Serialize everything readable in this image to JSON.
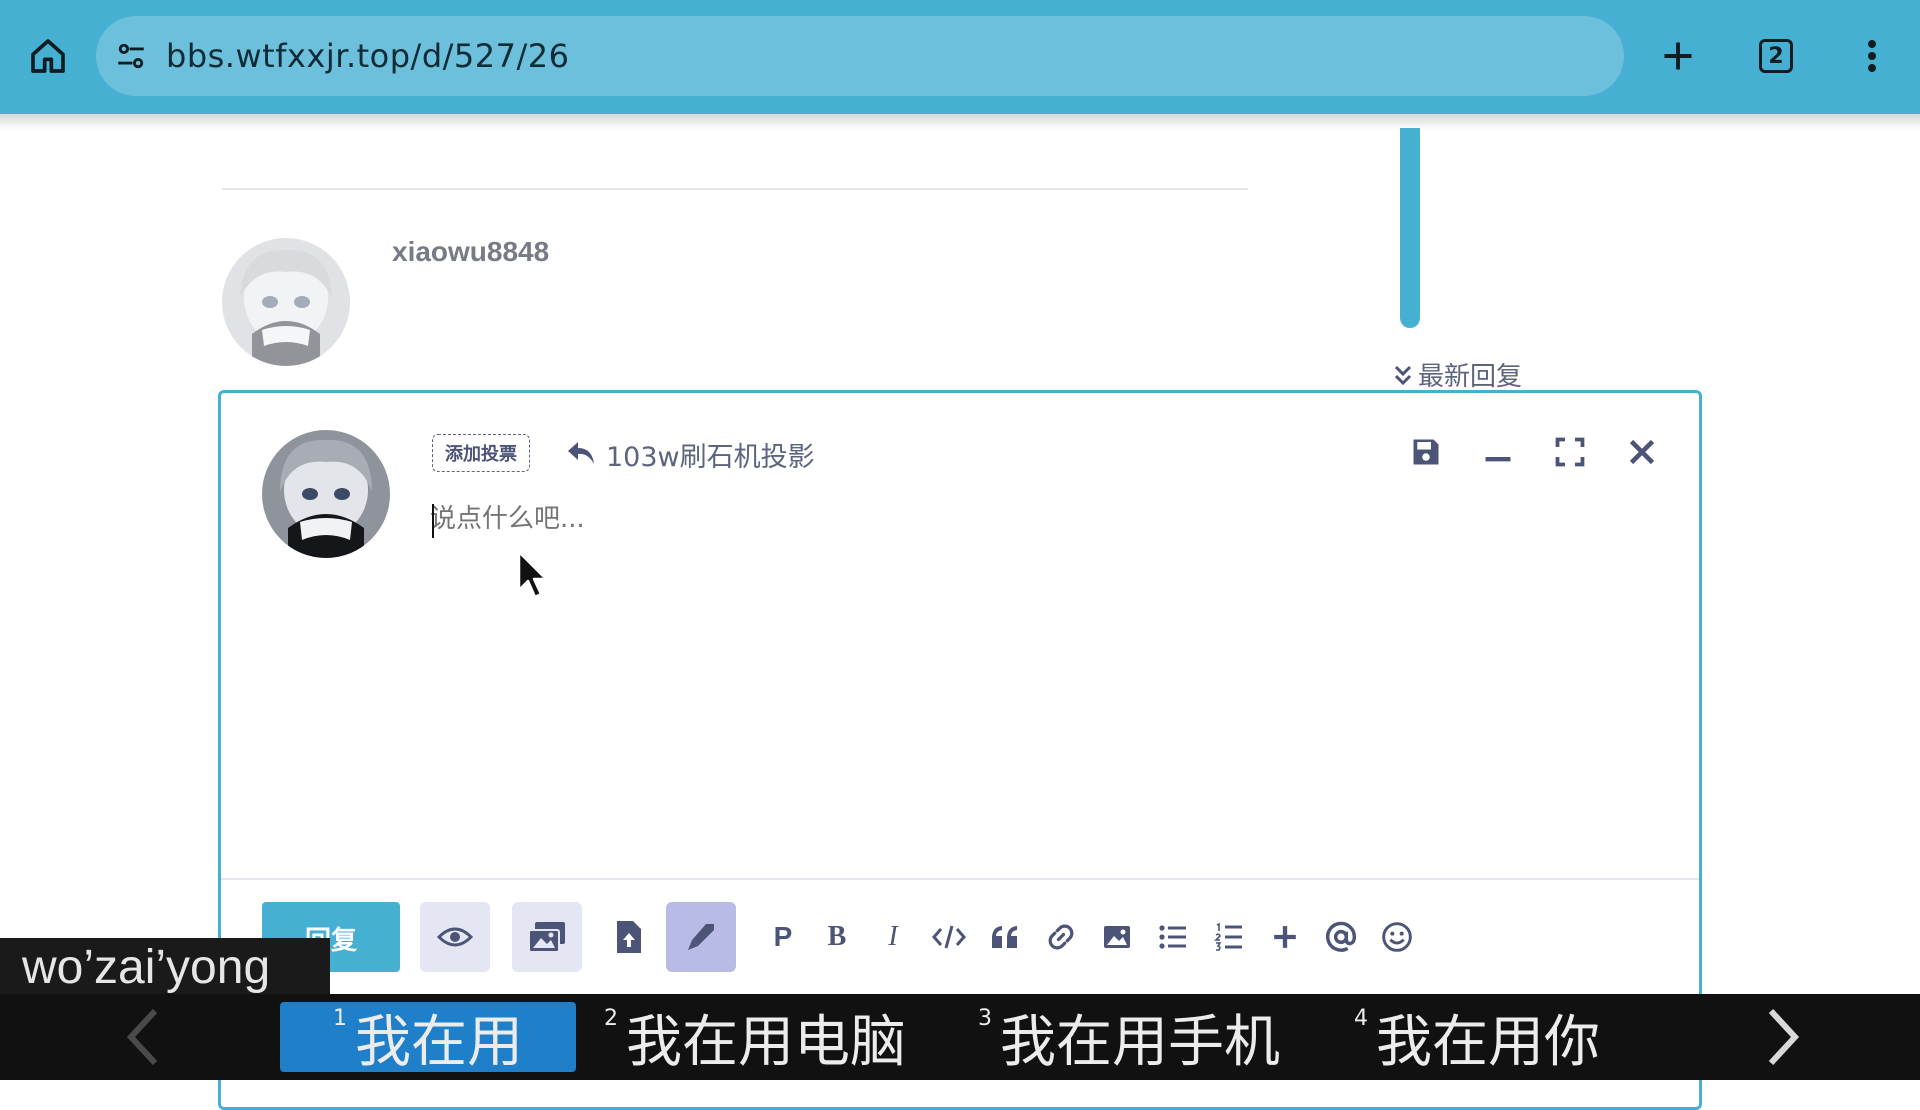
{
  "browser": {
    "url": "bbs.wtfxxjr.top/d/527/26",
    "tab_count": "2"
  },
  "post": {
    "author": "xiaowu8848"
  },
  "latest_reply_label": "最新回复",
  "composer": {
    "add_poll_label": "添加投票",
    "reply_to_title": "103w刷石机投影",
    "placeholder": "说点什么吧...",
    "submit_label": "回复",
    "format_buttons": {
      "paragraph": "P",
      "bold": "B",
      "italic": "I"
    }
  },
  "ime": {
    "composition": "wo’zai’yong",
    "candidates": [
      {
        "num": "1",
        "text": "我在用"
      },
      {
        "num": "2",
        "text": "我在用电脑"
      },
      {
        "num": "3",
        "text": "我在用手机"
      },
      {
        "num": "4",
        "text": "我在用你"
      }
    ]
  },
  "colors": {
    "accent": "#46b0d3",
    "text_muted": "#5d6480",
    "ime_highlight": "#1f7fc9"
  },
  "icons": [
    "home-icon",
    "site-settings-icon",
    "plus-icon",
    "tab-switcher-icon",
    "more-vert-icon",
    "double-chevron-down-icon",
    "reply-arrow-icon",
    "save-icon",
    "minimize-icon",
    "fullscreen-icon",
    "close-icon",
    "eye-icon",
    "media-icon",
    "upload-file-icon",
    "pen-icon",
    "code-icon",
    "quote-icon",
    "link-icon",
    "image-icon",
    "bullet-list-icon",
    "numbered-list-icon",
    "plus-icon",
    "at-icon",
    "emoji-icon",
    "chevron-left-icon",
    "chevron-right-icon"
  ]
}
